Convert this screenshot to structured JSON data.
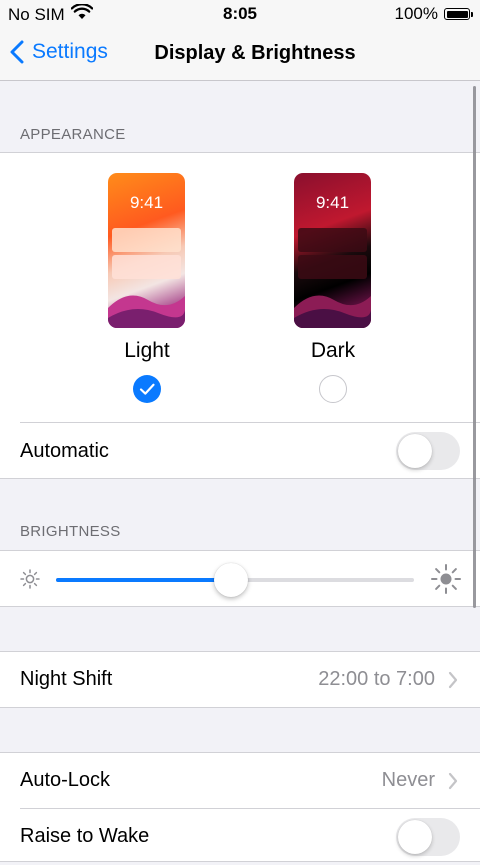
{
  "status": {
    "carrier": "No SIM",
    "time": "8:05",
    "battery": "100%"
  },
  "nav": {
    "back_label": "Settings",
    "title": "Display & Brightness"
  },
  "appearance": {
    "header": "APPEARANCE",
    "preview_time": "9:41",
    "light_label": "Light",
    "dark_label": "Dark",
    "selected": "Light",
    "automatic_label": "Automatic",
    "automatic_on": false
  },
  "brightness": {
    "header": "BRIGHTNESS",
    "level": 0.49
  },
  "night_shift": {
    "label": "Night Shift",
    "value": "22:00 to 7:00"
  },
  "auto_lock": {
    "label": "Auto-Lock",
    "value": "Never"
  },
  "raise_to_wake": {
    "label": "Raise to Wake",
    "on": false
  },
  "colors": {
    "accent": "#0a7aff",
    "toggle_off": "#e9e9eb",
    "background": "#f2f2f7"
  }
}
